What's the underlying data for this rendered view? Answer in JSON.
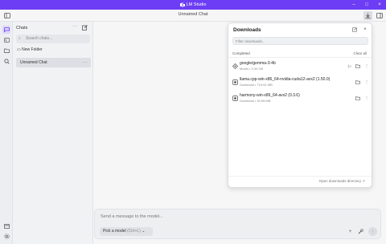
{
  "window": {
    "title": "LM Studio",
    "accent": "#6c3df4"
  },
  "appbar": {
    "title": "Unnamed Chat"
  },
  "rail": {
    "icons": [
      "chat-icon",
      "terminal-icon",
      "folder-icon",
      "search-icon",
      "box-icon",
      "gear-icon"
    ]
  },
  "sidebar": {
    "header": "Chats",
    "search_placeholder": "Search chats...",
    "new_folder_label": "New Folder",
    "chats": [
      {
        "label": "Unnamed Chat"
      }
    ]
  },
  "composer": {
    "placeholder": "Send a message to the model...",
    "pick_model_label": "Pick a model",
    "pick_model_hint": "(Ctrl+L)"
  },
  "downloads": {
    "title": "Downloads",
    "filter_placeholder": "Filter downloads...",
    "section_label": "Completed",
    "clear_all_label": "Clear all",
    "items": [
      {
        "name": "google/gemma-3-4b",
        "meta": "Model • 3.34 GB",
        "icon": "model-icon"
      },
      {
        "name": "llama.cpp-win-x86_64-nvidia-cuda12-avx2 (1.50.0)",
        "meta": "Download • 719.62 MB",
        "icon": "package-icon"
      },
      {
        "name": "harmony-win-x86_64-avx2 (0.3.6)",
        "meta": "Download • 30.58 MB",
        "icon": "package-icon"
      }
    ],
    "footer_link": "Open downloads directory"
  }
}
